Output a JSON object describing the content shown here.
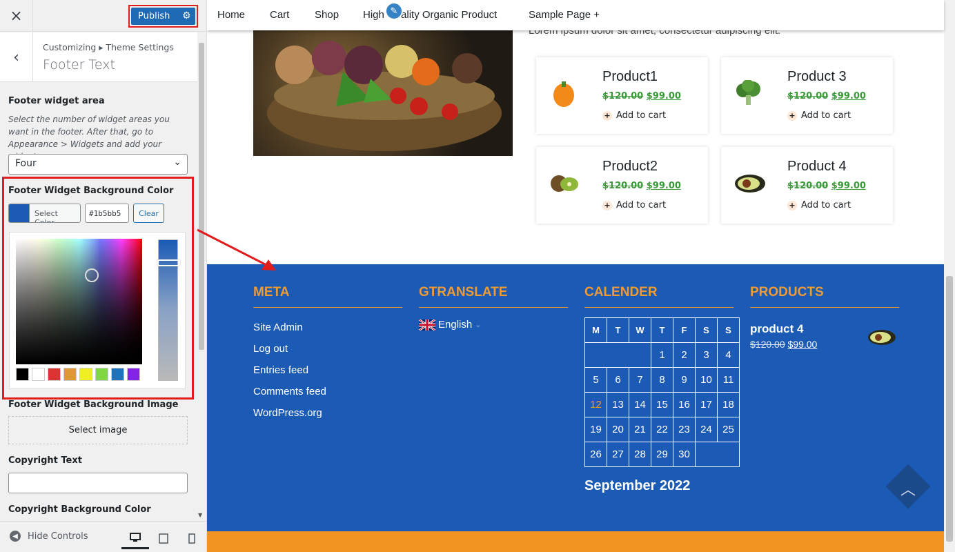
{
  "sidebar": {
    "close_icon": "×",
    "publish_label": "Publish",
    "back_icon": "‹",
    "breadcrumb": "Customizing ▸ Theme Settings",
    "section_title": "Footer Text",
    "widget_area": {
      "label": "Footer widget area",
      "description": "Select the number of widget areas you want in the footer. After that, go to Appearance > Widgets and add your widgets.",
      "selected": "Four"
    },
    "bg_color": {
      "label": "Footer Widget Background Color",
      "select_label": "Select Color",
      "hex": "#1b5bb5",
      "clear_label": "Clear",
      "color": "#1b5bb5",
      "palette": [
        "#000000",
        "#ffffff",
        "#dd3333",
        "#dd9933",
        "#eeee22",
        "#81d742",
        "#1e73be",
        "#8224e3"
      ]
    },
    "bg_image": {
      "label": "Footer Widget Background Image",
      "button": "Select image"
    },
    "copyright_text": {
      "label": "Copyright Text",
      "value": ""
    },
    "copyright_bg": {
      "label": "Copyright Background Color"
    },
    "hide_controls": "Hide Controls",
    "devices": [
      "desktop-icon",
      "tablet-icon",
      "mobile-icon"
    ]
  },
  "preview": {
    "nav": [
      "Home",
      "Cart",
      "Shop",
      "High Quality Organic Product",
      "Sample Page +"
    ],
    "lorem": "Lorem ipsum dolor sit amet, consectetur adipiscing elit.",
    "products": [
      {
        "name": "Product1",
        "old": "$120.00",
        "new": "$99.00",
        "add": "Add to cart",
        "icon": "pepper-icon"
      },
      {
        "name": "Product 3",
        "old": "$120.00",
        "new": "$99.00",
        "add": "Add to cart",
        "icon": "broccoli-icon"
      },
      {
        "name": "Product2",
        "old": "$120.00",
        "new": "$99.00",
        "add": "Add to cart",
        "icon": "kiwi-icon"
      },
      {
        "name": "Product 4",
        "old": "$120.00",
        "new": "$99.00",
        "add": "Add to cart",
        "icon": "avocado-icon"
      }
    ],
    "footer": {
      "meta_title": "META",
      "meta_links": [
        "Site Admin",
        "Log out",
        "Entries feed",
        "Comments feed",
        "WordPress.org"
      ],
      "gtranslate_title": "GTRANSLATE",
      "language": "English",
      "calender_title": "CALENDER",
      "calendar_days": [
        "M",
        "T",
        "W",
        "T",
        "F",
        "S",
        "S"
      ],
      "calendar_rows": [
        [
          "",
          "",
          "",
          "1",
          "2",
          "3",
          "4"
        ],
        [
          "5",
          "6",
          "7",
          "8",
          "9",
          "10",
          "11"
        ],
        [
          "12",
          "13",
          "14",
          "15",
          "16",
          "17",
          "18"
        ],
        [
          "19",
          "20",
          "21",
          "22",
          "23",
          "24",
          "25"
        ],
        [
          "26",
          "27",
          "28",
          "29",
          "30",
          "",
          ""
        ]
      ],
      "calendar_caption": "September 2022",
      "today": "12",
      "products_title": "PRODUCTS",
      "widget_product": {
        "name": "product 4",
        "old": "$120.00",
        "new": "$99.00"
      },
      "bg": "#1b5bb5",
      "accent": "#f09a33",
      "bottom_bar": "#f39422"
    }
  }
}
